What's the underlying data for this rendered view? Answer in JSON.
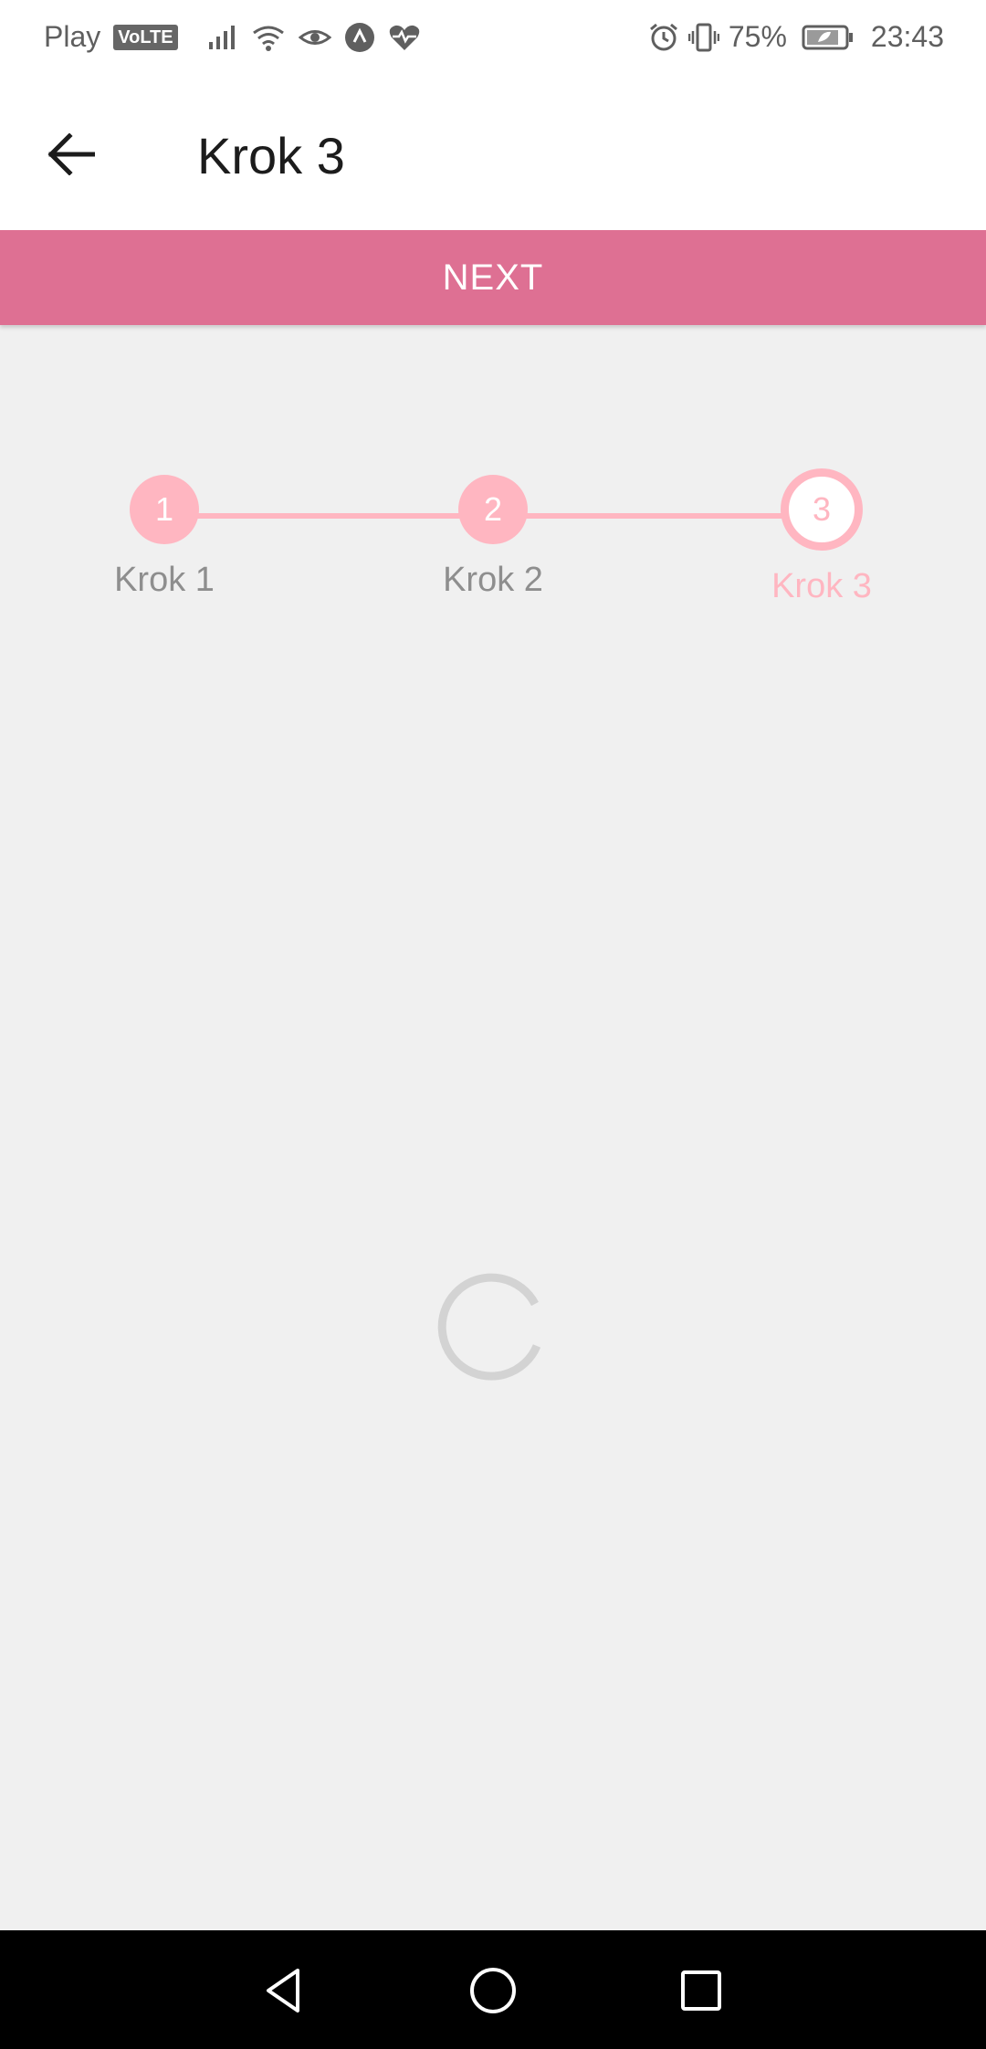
{
  "status_bar": {
    "carrier": "Play",
    "volte": "VoLTE",
    "battery_percent": "75%",
    "time": "23:43",
    "icons_left": [
      "signal-icon",
      "wifi-icon",
      "eye-icon",
      "app-icon",
      "heart-rate-icon"
    ],
    "icons_right": [
      "alarm-icon",
      "vibrate-icon",
      "battery-icon"
    ]
  },
  "app_bar": {
    "title": "Krok 3",
    "back_icon": "arrow-left-icon"
  },
  "next_button": {
    "label": "NEXT"
  },
  "stepper": {
    "accent_color": "#ffb6c1",
    "active_index": 2,
    "steps": [
      {
        "number": "1",
        "label": "Krok 1"
      },
      {
        "number": "2",
        "label": "Krok 2"
      },
      {
        "number": "3",
        "label": "Krok 3"
      }
    ]
  },
  "colors": {
    "primary": "#de7093",
    "background": "#f0f0f0"
  },
  "nav_bar": {
    "buttons": [
      "back-triangle-icon",
      "home-circle-icon",
      "recents-square-icon"
    ]
  }
}
